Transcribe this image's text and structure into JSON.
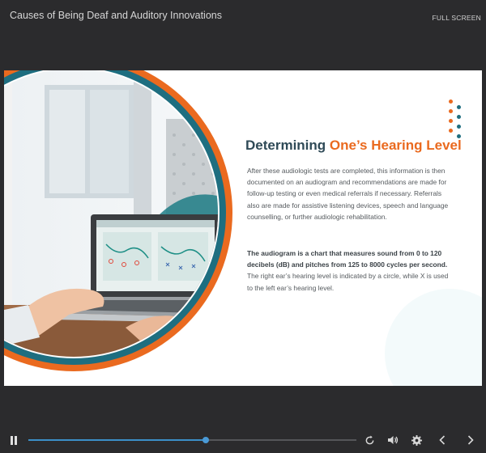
{
  "header": {
    "course_title": "Causes of Being Deaf and Auditory Innovations",
    "fullscreen_label": "FULL SCREEN"
  },
  "slide": {
    "heading_part1": "Determining ",
    "heading_part2": "One’s Hearing Level",
    "paragraph1": "After these audiologic tests are completed, this information is then documented on an audiogram and recommendations are made for follow-up testing or even medical referrals if necessary. Referrals also are made for assistive listening devices, speech and language counselling, or further audiologic rehabilitation.",
    "paragraph2_bold": "The audiogram is a chart that measures sound from 0 to 120 decibels (dB) and pitches from 125 to 8000 cycles per second.",
    "paragraph2_rest": " The right ear’s hearing level is indicated by a circle, while X is used to the left ear’s hearing level."
  },
  "colors": {
    "orange": "#ea6a1f",
    "teal": "#1e6e80",
    "heading_dark": "#2f4a57",
    "progress": "#3c8fc8"
  },
  "player": {
    "progress_fraction": 0.54,
    "icons": [
      "pause-icon",
      "replay-icon",
      "volume-icon",
      "settings-icon",
      "prev-icon",
      "next-icon"
    ]
  }
}
